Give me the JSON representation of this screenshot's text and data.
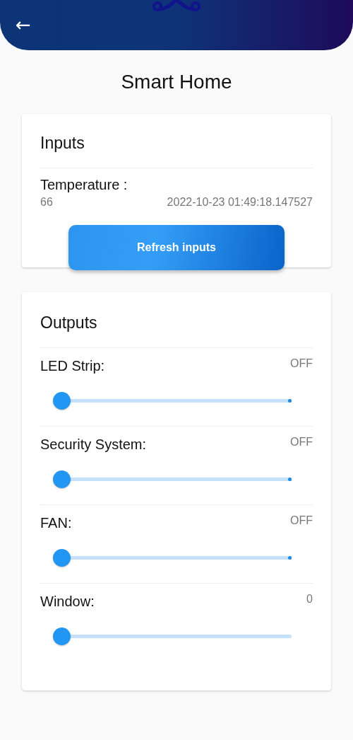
{
  "app_bar": {
    "back": "←"
  },
  "title": "Smart Home",
  "inputs": {
    "heading": "Inputs",
    "sensors": [
      {
        "name": "Temperature :",
        "value": "66",
        "time": "2022-10-23 01:49:18.147527"
      }
    ],
    "button": "Refresh inputs"
  },
  "outputs": {
    "heading": "Outputs",
    "controls": [
      {
        "name": "LED Strip:",
        "reading": "OFF",
        "level": 0,
        "discrete": true
      },
      {
        "name": "Security System:",
        "reading": "OFF",
        "level": 0,
        "discrete": true
      },
      {
        "name": "FAN:",
        "reading": "OFF",
        "level": 0,
        "discrete": true
      },
      {
        "name": "Window:",
        "reading": "0",
        "level": 0,
        "discrete": false
      }
    ]
  }
}
